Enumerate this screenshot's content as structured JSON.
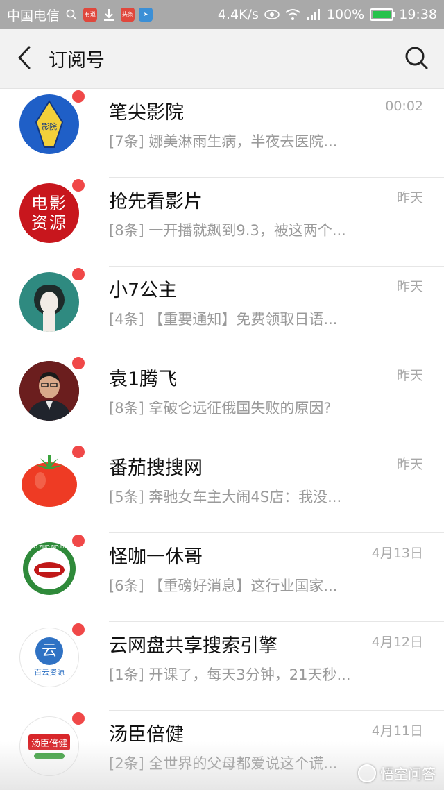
{
  "status_bar": {
    "carrier": "中国电信",
    "badge1": "有道",
    "badge2": "头条",
    "speed": "4.4K/s",
    "battery_pct": "100%",
    "battery_level": 1.0,
    "time": "19:38"
  },
  "header": {
    "title": "订阅号",
    "back_icon": "chevron-left-icon",
    "search_icon": "search-icon"
  },
  "colors": {
    "unread_dot": "#f04848",
    "status_bar": "#a9a9a9",
    "header_bg": "#f2f2f2"
  },
  "subscriptions": [
    {
      "name": "笔尖影院",
      "time": "00:02",
      "preview": "[7条] 娜美淋雨生病，半夜去医院...",
      "avatar_text": "影院"
    },
    {
      "name": "抢先看影片",
      "time": "昨天",
      "preview": "[8条] 一开播就飙到9.3，被这两个...",
      "avatar_text": "电影资源"
    },
    {
      "name": "小7公主",
      "time": "昨天",
      "preview": "[4条] 【重要通知】免费领取日语...",
      "avatar_text": ""
    },
    {
      "name": "袁1腾飞",
      "time": "昨天",
      "preview": "[8条] 拿破仑远征俄国失败的原因?",
      "avatar_text": ""
    },
    {
      "name": "番茄搜搜网",
      "time": "昨天",
      "preview": "[5条] 奔驰女车主大闹4S店：我没...",
      "avatar_text": ""
    },
    {
      "name": "怪咖一休哥",
      "time": "4月13日",
      "preview": "[6条] 【重磅好消息】这行业国家...",
      "avatar_text": "NO ZUO NO DIE"
    },
    {
      "name": "云网盘共享搜索引擎",
      "time": "4月12日",
      "preview": "[1条] 开课了，每天3分钟，21天秒...",
      "avatar_text": "云",
      "avatar_sub": "百云资源"
    },
    {
      "name": "汤臣倍健",
      "time": "4月11日",
      "preview": "[2条] 全世界的父母都爱说这个谎...",
      "avatar_text": "汤臣倍健"
    }
  ],
  "watermark": "悟空问答"
}
